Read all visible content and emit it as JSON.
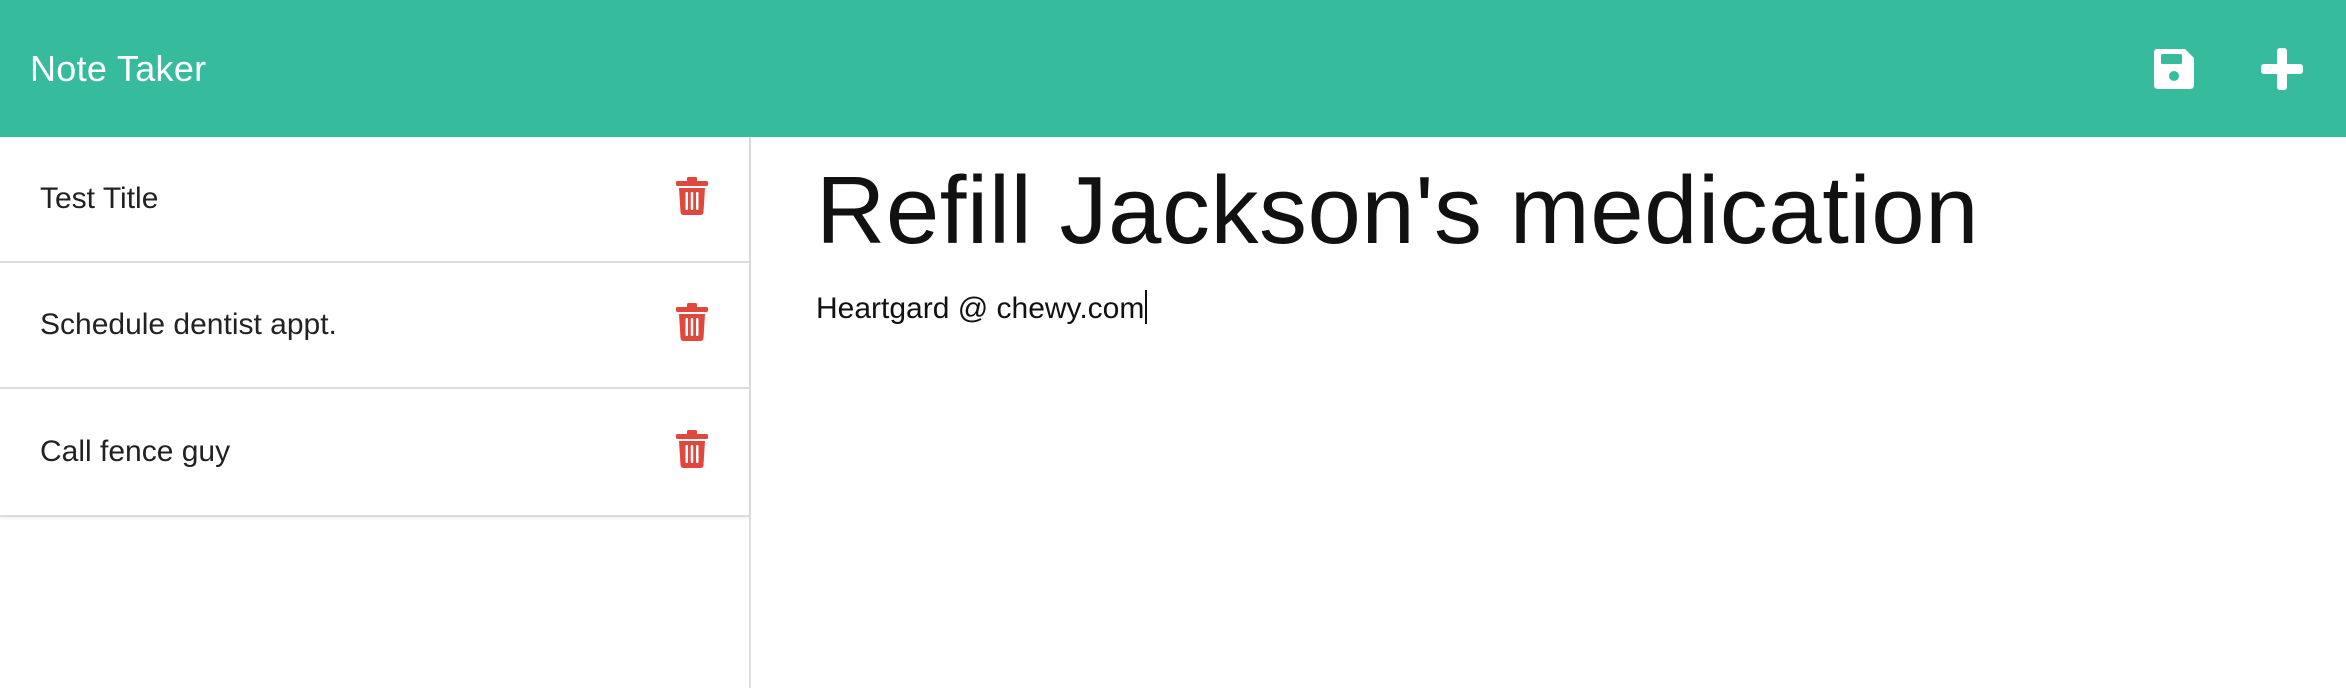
{
  "app": {
    "title": "Note Taker",
    "accent_color": "#36bc9c",
    "delete_color": "#e0483e"
  },
  "toolbar": {
    "save_icon": "floppy-disk-icon",
    "new_icon": "plus-icon"
  },
  "notes": [
    {
      "title": "Test Title"
    },
    {
      "title": "Schedule dentist appt."
    },
    {
      "title": "Call fence guy"
    }
  ],
  "editor": {
    "title": "Refill Jackson's medication",
    "text": "Heartgard @ chewy.com"
  }
}
